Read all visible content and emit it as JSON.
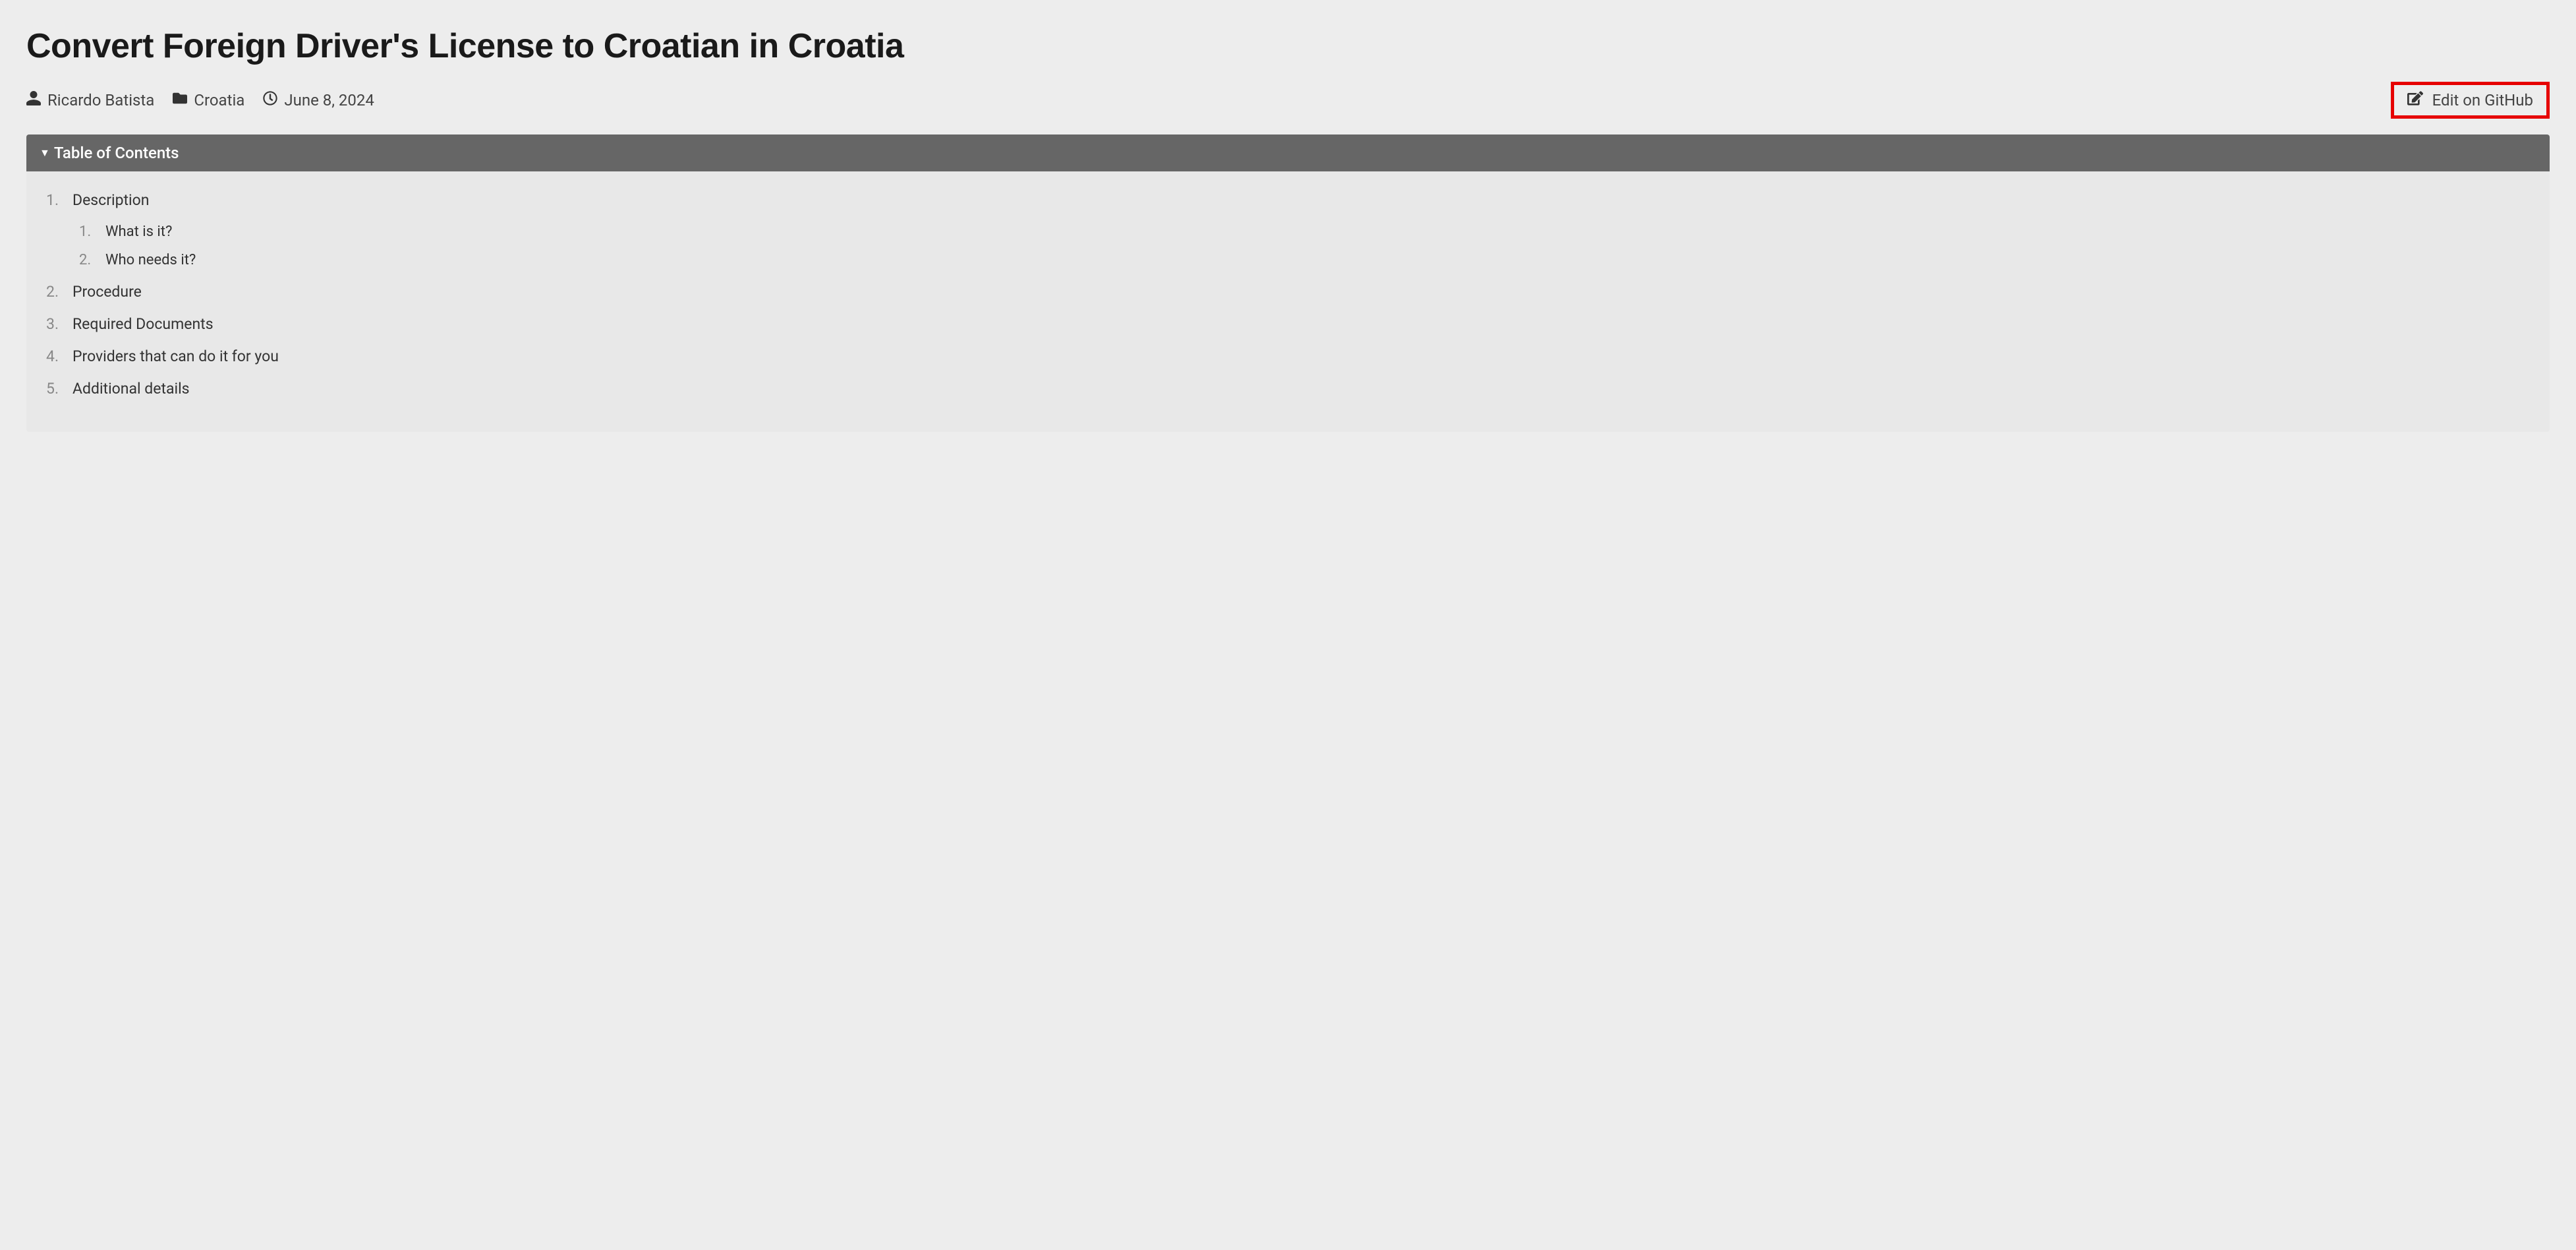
{
  "title": "Convert Foreign Driver's License to Croatian in Croatia",
  "meta": {
    "author": "Ricardo Batista",
    "category": "Croatia",
    "date": "June 8, 2024"
  },
  "edit_link": {
    "label": "Edit on GitHub"
  },
  "toc": {
    "header": "Table of Contents",
    "items": [
      {
        "label": "Description",
        "children": [
          {
            "label": "What is it?"
          },
          {
            "label": "Who needs it?"
          }
        ]
      },
      {
        "label": "Procedure"
      },
      {
        "label": "Required Documents"
      },
      {
        "label": "Providers that can do it for you"
      },
      {
        "label": "Additional details"
      }
    ]
  }
}
